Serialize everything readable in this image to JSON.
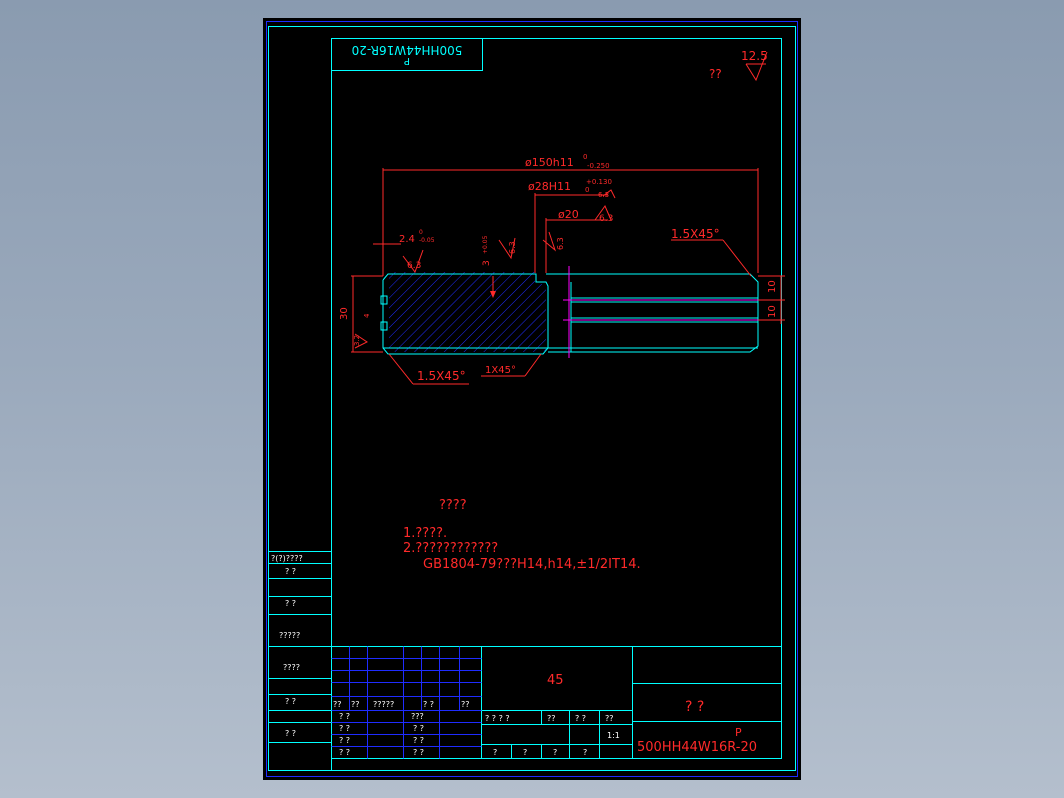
{
  "title_block": {
    "mirror_code": "500HH44W16R-20",
    "mirror_letter": "P",
    "material": "45",
    "part_name": "?  ?",
    "drawing_letter": "P",
    "drawing_number": "500HH44W16R-20",
    "scale": "1:1",
    "header_cells": [
      "?  ?  ?  ?",
      "??",
      "?  ?",
      "??",
      "??"
    ],
    "left_row_labels": [
      "??",
      "??",
      "?????"
    ],
    "left_rows": [
      "?  ?",
      "?  ?",
      "?  ?",
      "?  ?"
    ],
    "mid_rows": [
      "???",
      "?  ?",
      "?  ?",
      "?  ?"
    ],
    "bottom_cells": [
      "?",
      "?",
      "?",
      "?"
    ]
  },
  "side_strip": {
    "header": "?(?)????",
    "labels": [
      "?    ?",
      "?    ?",
      "?????",
      "????",
      "?    ?",
      "?    ?"
    ]
  },
  "surface_note": {
    "label": "??",
    "roughness": "12.5"
  },
  "dimensions": {
    "outer_dia": "ø150h11",
    "outer_dia_tol_upper": "0",
    "outer_dia_tol_lower": "-0.250",
    "bore_dia": "ø28H11",
    "bore_dia_tol_upper": "+0.130",
    "bore_dia_tol_lower": "0",
    "recess_dia": "ø20",
    "width_total": "30",
    "groove_width": "2.4",
    "groove_tol_upper": "0",
    "groove_tol_lower": "-0.05",
    "groove_depth": "3",
    "groove_depth_tol": "+0.05",
    "small_dim": "4",
    "right_dim_1": "10",
    "right_dim_2": "10",
    "chamfer_1": "1.5X45°",
    "chamfer_2": "1.5X45°",
    "chamfer_3": "1X45°",
    "roughness_a": "6.3",
    "roughness_b": "6.3",
    "roughness_c": "6.3",
    "roughness_d": "6.3",
    "roughness_e": "6.3",
    "roughness_f": "3.2"
  },
  "notes": {
    "heading": "????",
    "line1": "1.????.",
    "line2": "2.????????????",
    "line3": "GB1804-79???H14,h14,±1/2IT14."
  },
  "colors": {
    "background": "#8a9bb0",
    "sheet": "#000000",
    "frame": "#1f2cff",
    "lines": "#00ffff",
    "annotation": "#ff2a2a",
    "center": "#ff00ff"
  }
}
